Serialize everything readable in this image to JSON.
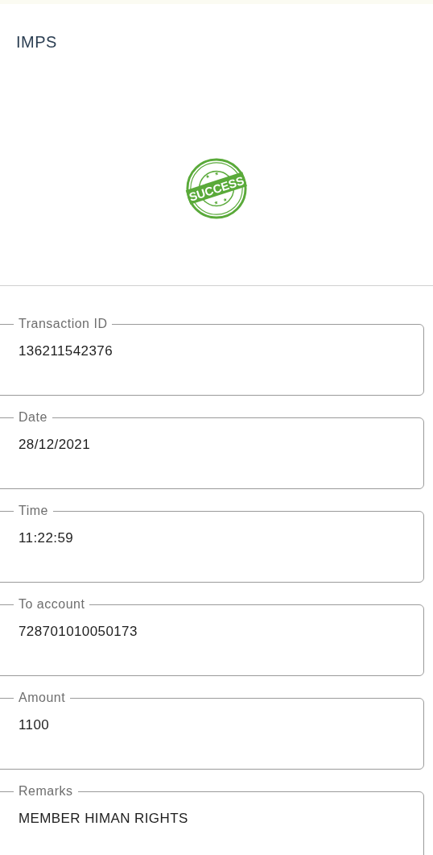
{
  "header": {
    "title": "IMPS"
  },
  "status": {
    "kind": "success",
    "stamp_text": "SUCCESS"
  },
  "fields": [
    {
      "label": "Transaction ID",
      "value": "136211542376"
    },
    {
      "label": "Date",
      "value": "28/12/2021"
    },
    {
      "label": "Time",
      "value": "11:22:59"
    },
    {
      "label": "To account",
      "value": "728701010050173"
    },
    {
      "label": "Amount",
      "value": "1100"
    },
    {
      "label": "Remarks",
      "value": "MEMBER HIMAN RIGHTS"
    }
  ]
}
